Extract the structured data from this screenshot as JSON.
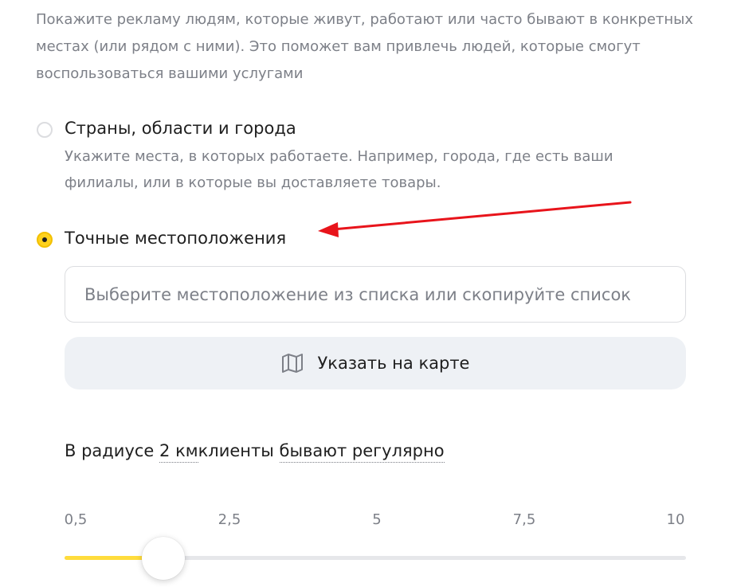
{
  "intro_text": "Покажите рекламу людям, которые живут, работают или часто бывают в конкретных местах (или рядом с ними). Это поможет вам привлечь людей, которые смогут воспользоваться вашими услугами",
  "options": [
    {
      "label": "Страны, области и города",
      "description": "Укажите места, в которых работаете. Например, города, где есть ваши филиалы, или в которые вы доставляете товары.",
      "selected": false
    },
    {
      "label": "Точные местоположения",
      "selected": true
    }
  ],
  "location_input": {
    "placeholder": "Выберите местоположение из списка или скопируйте список",
    "value": ""
  },
  "map_button": {
    "label": "Указать на карте",
    "icon": "map-icon"
  },
  "radius": {
    "prefix": "В радиусе",
    "value": "2 км",
    "middle": "клиенты",
    "frequency": "бывают регулярно"
  },
  "slider": {
    "ticks": [
      "0,5",
      "2,5",
      "5",
      "7,5",
      "10"
    ],
    "min": 0.5,
    "max": 10,
    "value": 2
  },
  "colors": {
    "accent_yellow": "#ffd21e",
    "muted_text": "#7d8088",
    "button_bg": "#eef1f5",
    "annotation_arrow": "#e8141b"
  }
}
